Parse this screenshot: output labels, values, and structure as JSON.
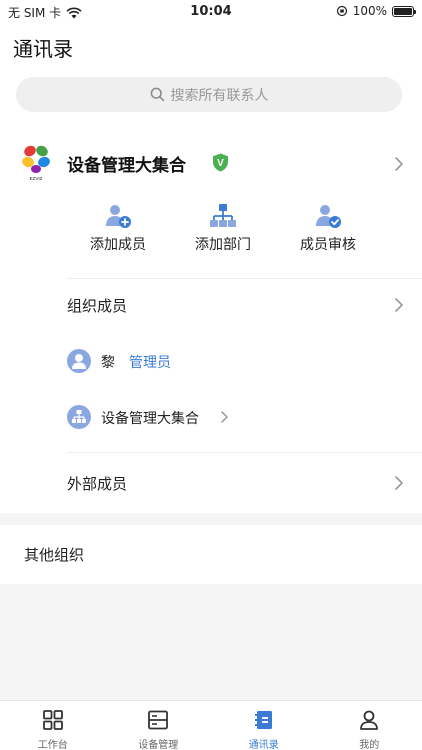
{
  "status_bar": {
    "carrier": "无 SIM 卡",
    "time": "10:04",
    "battery": "100%"
  },
  "header": {
    "title": "通讯录",
    "search_placeholder": "搜索所有联系人"
  },
  "org": {
    "name": "设备管理大集合",
    "verified_badge": "V",
    "logo_caption": "EZVIZ"
  },
  "actions": [
    {
      "label": "添加成员",
      "icon": "add-member-icon"
    },
    {
      "label": "添加部门",
      "icon": "add-department-icon"
    },
    {
      "label": "成员审核",
      "icon": "member-review-icon"
    }
  ],
  "org_members": {
    "label": "组织成员",
    "member": {
      "name": "黎",
      "role": "管理员"
    },
    "department": {
      "name": "设备管理大集合"
    }
  },
  "external_members": {
    "label": "外部成员"
  },
  "other_orgs": {
    "label": "其他组织"
  },
  "tabbar": {
    "tabs": [
      {
        "label": "工作台",
        "icon": "grid-icon"
      },
      {
        "label": "设备管理",
        "icon": "device-icon"
      },
      {
        "label": "通讯录",
        "icon": "contacts-icon",
        "active": true
      },
      {
        "label": "我的",
        "icon": "profile-icon"
      }
    ]
  },
  "colors": {
    "accent": "#3a7bd5",
    "verified": "#4caf50",
    "icon_blue": "#8aa7e0"
  }
}
